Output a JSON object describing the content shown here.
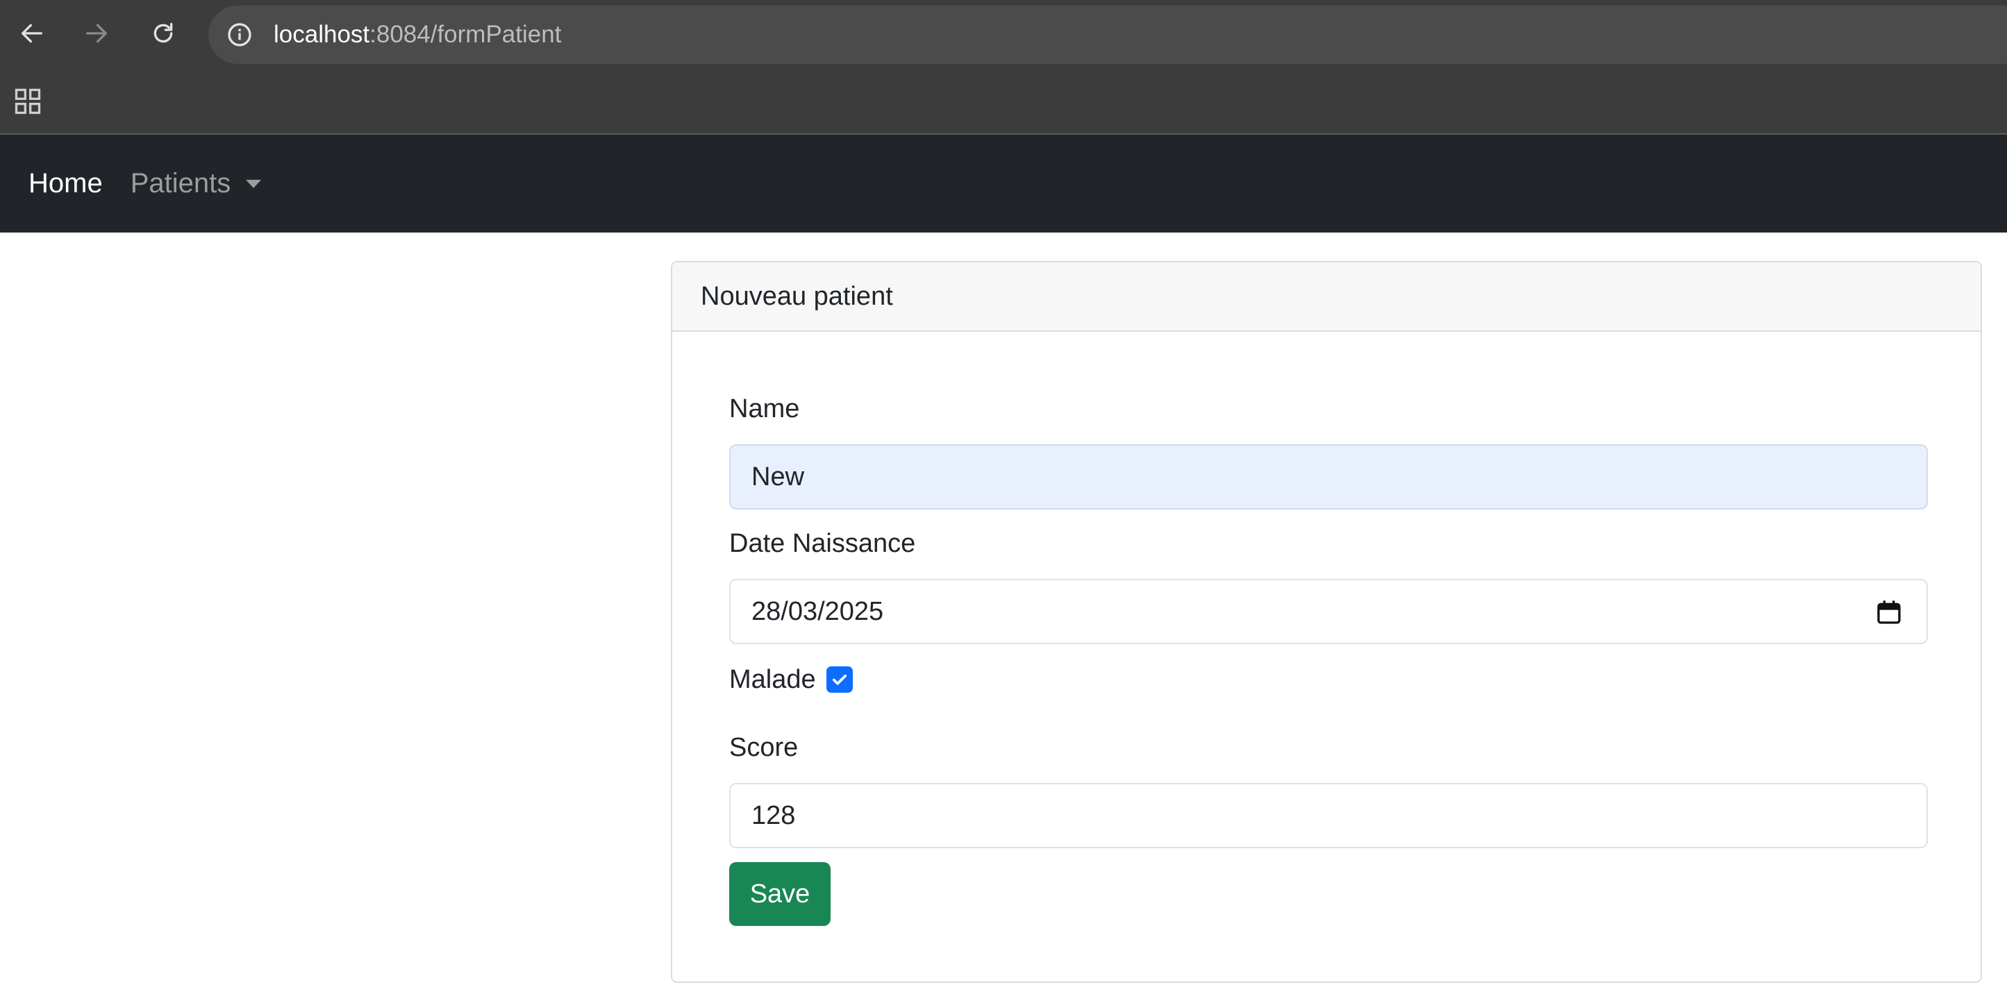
{
  "browser": {
    "url_host": "localhost",
    "url_rest": ":8084/formPatient"
  },
  "navbar": {
    "home_label": "Home",
    "patients_label": "Patients"
  },
  "card": {
    "title": "Nouveau patient"
  },
  "form": {
    "name_label": "Name",
    "name_value": "New",
    "date_label": "Date Naissance",
    "date_value": "28/03/2025",
    "malade_label": "Malade",
    "malade_checked": true,
    "score_label": "Score",
    "score_value": "128",
    "save_label": "Save"
  },
  "colors": {
    "navbar_bg": "#212529",
    "save_button": "#198754",
    "checkbox_checked": "#0d6efd",
    "autofill_bg": "#e8f0fe"
  }
}
